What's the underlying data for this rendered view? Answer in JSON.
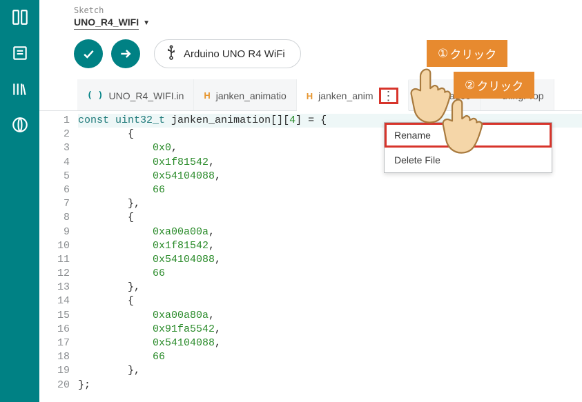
{
  "crumb": "Sketch",
  "project_name": "UNO_R4_WIFI",
  "board_name": "Arduino UNO R4 WiFi",
  "tabs": [
    {
      "ext": "( )",
      "ext_class": "ino",
      "label": "UNO_R4_WIFI.in"
    },
    {
      "ext": "H",
      "ext_class": "",
      "label": "janken_animatio"
    },
    {
      "ext": "H",
      "ext_class": "",
      "label": "janken_anim",
      "active": true,
      "has_dots": true
    },
    {
      "ext": "☰",
      "ext_class": "readme",
      "label": "Re        .adoc"
    },
    {
      "ext": "H",
      "ext_class": "",
      "label": "thingProp"
    }
  ],
  "dropdown": {
    "rename": "Rename",
    "delete": "Delete File"
  },
  "callouts": {
    "one_num": "①",
    "one_text": "クリック",
    "two_num": "②",
    "two_text": "クリック"
  },
  "code": {
    "lines": [
      {
        "n": 1,
        "html": "<span class='kw'>const</span> <span class='type'>uint32_t</span> janken_animation[][<span class='num'>4</span>] = {"
      },
      {
        "n": 2,
        "html": "        {"
      },
      {
        "n": 3,
        "html": "            <span class='num'>0x0</span>,"
      },
      {
        "n": 4,
        "html": "            <span class='num'>0x1f81542</span>,"
      },
      {
        "n": 5,
        "html": "            <span class='num'>0x54104088</span>,"
      },
      {
        "n": 6,
        "html": "            <span class='num'>66</span>"
      },
      {
        "n": 7,
        "html": "        },"
      },
      {
        "n": 8,
        "html": "        {"
      },
      {
        "n": 9,
        "html": "            <span class='num'>0xa00a00a</span>,"
      },
      {
        "n": 10,
        "html": "            <span class='num'>0x1f81542</span>,"
      },
      {
        "n": 11,
        "html": "            <span class='num'>0x54104088</span>,"
      },
      {
        "n": 12,
        "html": "            <span class='num'>66</span>"
      },
      {
        "n": 13,
        "html": "        },"
      },
      {
        "n": 14,
        "html": "        {"
      },
      {
        "n": 15,
        "html": "            <span class='num'>0xa00a80a</span>,"
      },
      {
        "n": 16,
        "html": "            <span class='num'>0x91fa5542</span>,"
      },
      {
        "n": 17,
        "html": "            <span class='num'>0x54104088</span>,"
      },
      {
        "n": 18,
        "html": "            <span class='num'>66</span>"
      },
      {
        "n": 19,
        "html": "        },"
      },
      {
        "n": 20,
        "html": "};"
      }
    ]
  }
}
